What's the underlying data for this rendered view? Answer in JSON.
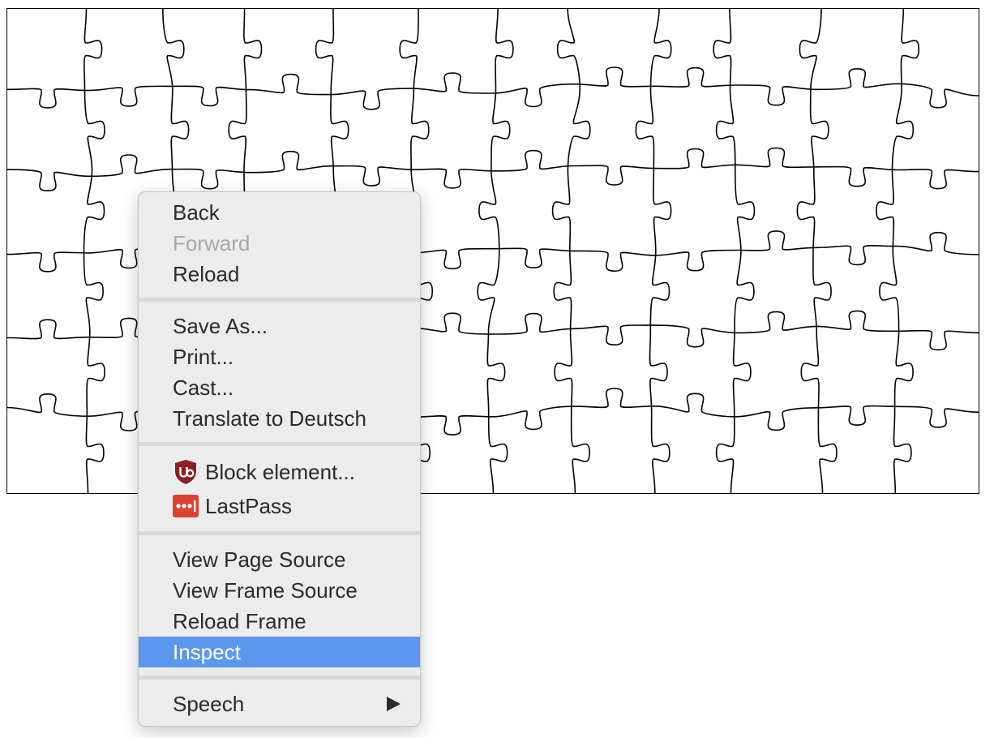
{
  "context_menu": {
    "items": [
      {
        "label": "Back",
        "disabled": false
      },
      {
        "label": "Forward",
        "disabled": true
      },
      {
        "label": "Reload",
        "disabled": false
      }
    ],
    "page_actions": [
      {
        "label": "Save As..."
      },
      {
        "label": "Print..."
      },
      {
        "label": "Cast..."
      },
      {
        "label": "Translate to Deutsch"
      }
    ],
    "extensions": [
      {
        "label": "Block element...",
        "icon": "ublock-origin-icon",
        "color": "#8b1e1e"
      },
      {
        "label": "LastPass",
        "icon": "lastpass-icon",
        "color": "#d9432f"
      }
    ],
    "developer": [
      {
        "label": "View Page Source"
      },
      {
        "label": "View Frame Source"
      },
      {
        "label": "Reload Frame"
      },
      {
        "label": "Inspect",
        "highlighted": true
      }
    ],
    "speech": {
      "label": "Speech",
      "has_submenu": true
    },
    "colors": {
      "highlight": "#5c97ee",
      "background": "#ececec",
      "text": "#2a2a2a",
      "disabled_text": "#a8a8a8"
    }
  },
  "puzzle": {
    "columns": 12,
    "rows": 6,
    "stroke_color": "#000000"
  }
}
